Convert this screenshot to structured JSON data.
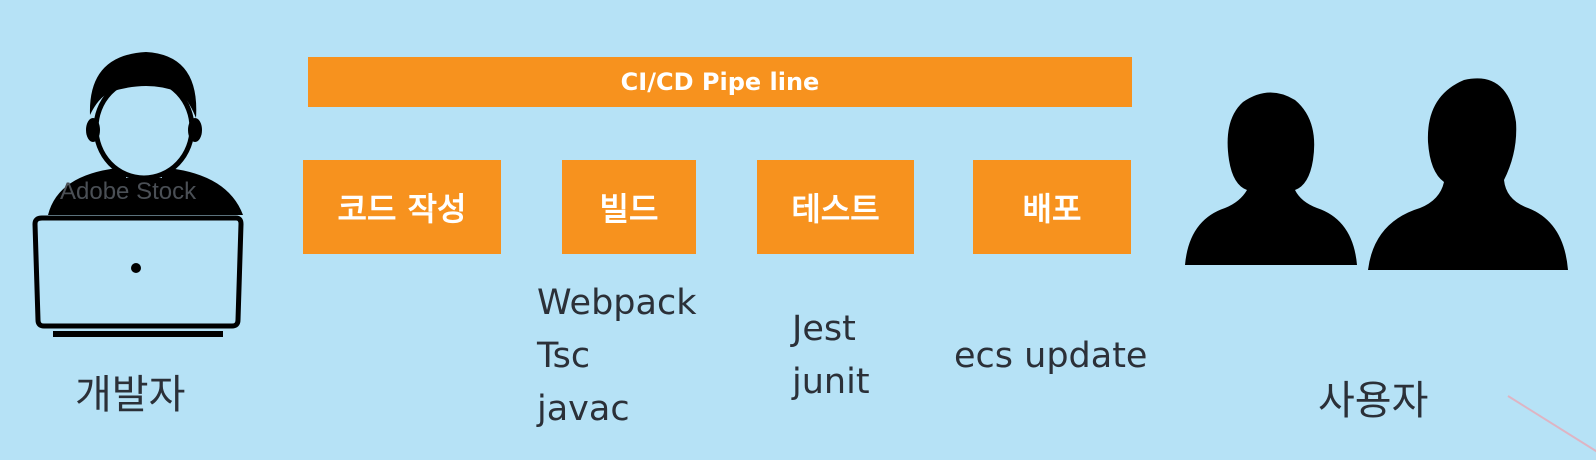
{
  "pipeline": {
    "label": "CI/CD Pipe line"
  },
  "stages": [
    {
      "label": "코드 작성"
    },
    {
      "label": "빌드"
    },
    {
      "label": "테스트"
    },
    {
      "label": "배포"
    }
  ],
  "tools": {
    "build": "Webpack\nTsc\njavac",
    "test": "Jest\njunit",
    "deploy": "ecs update"
  },
  "actors": {
    "developer": "개발자",
    "users": "사용자"
  },
  "watermark": "Adobe Stock",
  "colors": {
    "background": "#b6e2f6",
    "orange": "#f7921e",
    "figure": "#000000"
  },
  "icons": [
    "developer-laptop-icon",
    "female-user-icon",
    "male-user-icon"
  ]
}
